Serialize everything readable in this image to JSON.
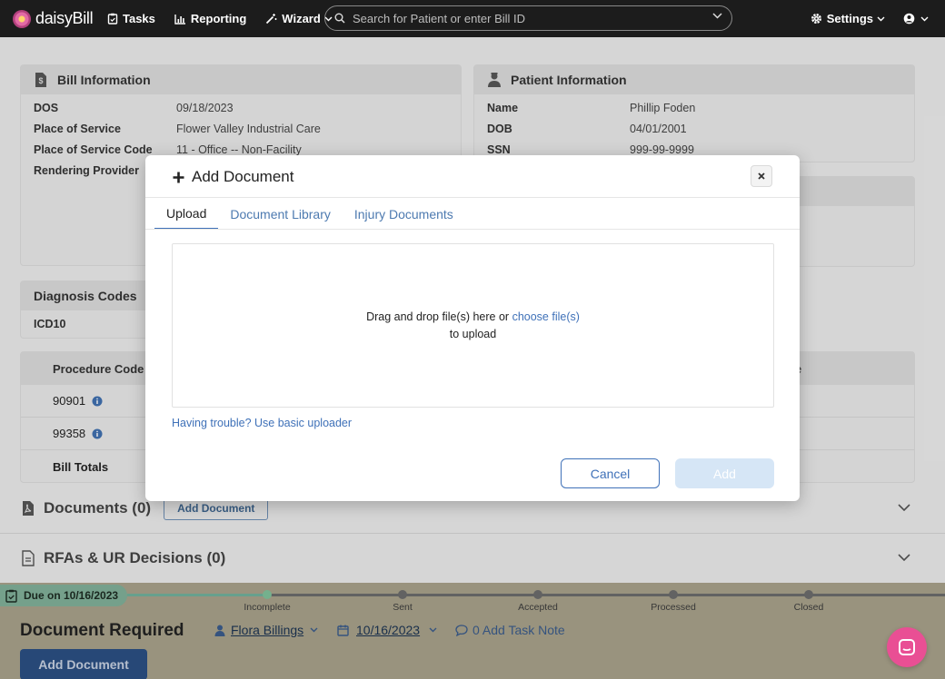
{
  "nav": {
    "brand": "daisyBill",
    "tasks": "Tasks",
    "reporting": "Reporting",
    "wizard": "Wizard",
    "search_placeholder": "Search for Patient or enter Bill ID",
    "settings": "Settings"
  },
  "bill_info": {
    "title": "Bill Information",
    "rows": [
      {
        "label": "DOS",
        "value": "09/18/2023"
      },
      {
        "label": "Place of Service",
        "value": "Flower Valley Industrial Care"
      },
      {
        "label": "Place of Service Code",
        "value": "11 - Office -- Non-Facility"
      },
      {
        "label": "Rendering Provider",
        "value": ""
      }
    ]
  },
  "patient_info": {
    "title": "Patient Information",
    "rows": [
      {
        "label": "Name",
        "value": "Phillip Foden"
      },
      {
        "label": "DOB",
        "value": "04/01/2001"
      },
      {
        "label": "SSN",
        "value": "999-99-9999"
      }
    ]
  },
  "diagnosis": {
    "title": "Diagnosis Codes",
    "icd_label": "ICD10"
  },
  "procedures": {
    "header": "Procedure Code",
    "header_right_fragment": "e",
    "codes": [
      "90901",
      "99358"
    ],
    "totals": "Bill Totals"
  },
  "sections": {
    "documents": "Documents (0)",
    "add_document": "Add Document",
    "rfas": "RFAs & UR Decisions (0)"
  },
  "status": {
    "due": "Due on 10/16/2023",
    "steps": [
      "Incomplete",
      "Sent",
      "Accepted",
      "Processed",
      "Closed"
    ],
    "title": "Document Required",
    "assignee": "Flora Billings",
    "date": "10/16/2023",
    "task_note": "0 Add Task Note",
    "add_document": "Add Document"
  },
  "modal": {
    "title": "Add Document",
    "tabs": [
      "Upload",
      "Document Library",
      "Injury Documents"
    ],
    "drop_text": "Drag and drop file(s) here or",
    "choose": "choose file(s)",
    "to_upload": "to upload",
    "trouble": "Having trouble? Use basic uploader",
    "cancel": "Cancel",
    "add": "Add"
  }
}
